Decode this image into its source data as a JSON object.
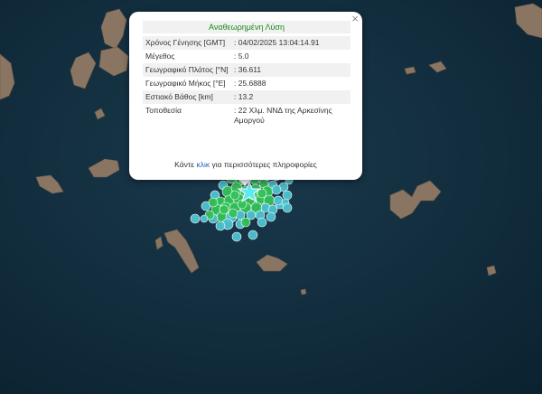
{
  "popup": {
    "title": "Αναθεωρημένη Λύση",
    "rows": [
      {
        "label": "Χρόνος Γένησης [GMT]",
        "value": ": 04/02/2025 13:04:14.91"
      },
      {
        "label": "Μέγεθος",
        "value": ": 5.0"
      },
      {
        "label": "Γεωγραφικό Πλάτος [°N]",
        "value": ": 36.611"
      },
      {
        "label": "Γεωγραφικό Μήκος [°E]",
        "value": ": 25.6888"
      },
      {
        "label": "Εστιακό Βάθος [km]",
        "value": ": 13.2"
      },
      {
        "label": "Τοποθεσία",
        "value": ": 22 Χλμ. ΝΝΔ της Αρκεσίνης Αμοργού"
      }
    ],
    "more_prefix": "Κάντε",
    "more_link": "κλικ",
    "more_suffix": "για περισσότερες πληροφορίες",
    "close": "×"
  },
  "colors": {
    "sea": "#0f2a3a",
    "land": "#8a7560",
    "event_recent": "#33c25a",
    "event_older": "#4cc3d1",
    "main_shock": "#5ee8f5"
  },
  "icons": {
    "main_event": "star-icon",
    "close": "close-icon"
  }
}
